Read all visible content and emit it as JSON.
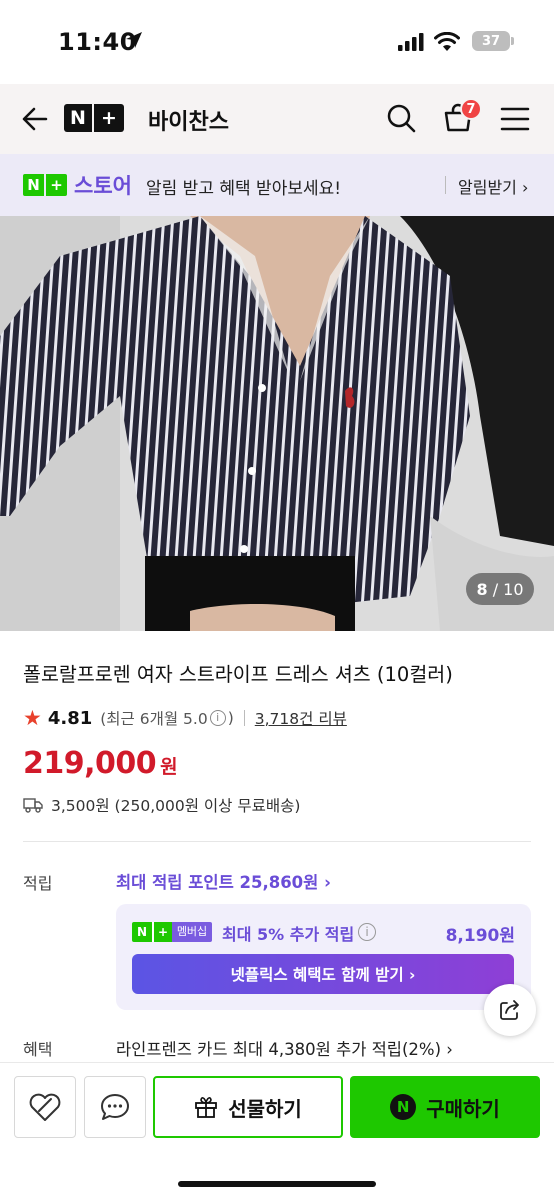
{
  "status_bar": {
    "time": "11:40",
    "battery": "37"
  },
  "app_bar": {
    "logo_n": "N",
    "logo_plus": "+",
    "store_name": "바이찬스",
    "cart_count": "7"
  },
  "promo_banner": {
    "badge_n": "N",
    "badge_plus": "+",
    "brand": "스토어",
    "message": "알림 받고 혜택 받아보세요!",
    "link": "알림받기 ›"
  },
  "product": {
    "image_pager_current": "8",
    "image_pager_total": "/ 10",
    "title": "폴로랄프로렌 여자 스트라이프 드레스 셔츠 (10컬러)",
    "rating": "4.81",
    "rating_recent": "(최근 6개월 5.0",
    "rating_recent_close": ")",
    "review_count": "3,718건 리뷰",
    "price": "219,000",
    "price_unit": "원",
    "shipping": "3,500원 (250,000원 이상 무료배송)"
  },
  "points": {
    "label": "적립",
    "max_points": "최대 적립 포인트 25,860원 ›",
    "membership_badge_n": "N",
    "membership_badge_plus": "+",
    "membership_badge_text": "멤버십",
    "membership_extra": "최대 5% 추가 적립",
    "membership_amount": "8,190원",
    "netflix_button": "넷플릭스 혜택도 함께 받기 ›"
  },
  "benefits": {
    "label": "혜택",
    "card_benefit": "라인프렌즈 카드 최대 4,380원 추가 적립(2%) ›"
  },
  "bottom_bar": {
    "gift_label": "선물하기",
    "buy_label": "구매하기",
    "npay_letter": "N"
  },
  "colors": {
    "naver_green": "#1ec800",
    "purple": "#6a4dd7",
    "price_red": "#d11a2a",
    "star": "#e8412c"
  },
  "icons": [
    "location-arrow-icon",
    "signal-icon",
    "wifi-icon",
    "battery-icon",
    "back-arrow-icon",
    "search-icon",
    "cart-icon",
    "menu-icon",
    "star-icon",
    "info-icon",
    "truck-icon",
    "share-icon",
    "heart-icon",
    "chat-icon",
    "gift-icon",
    "npay-icon"
  ]
}
